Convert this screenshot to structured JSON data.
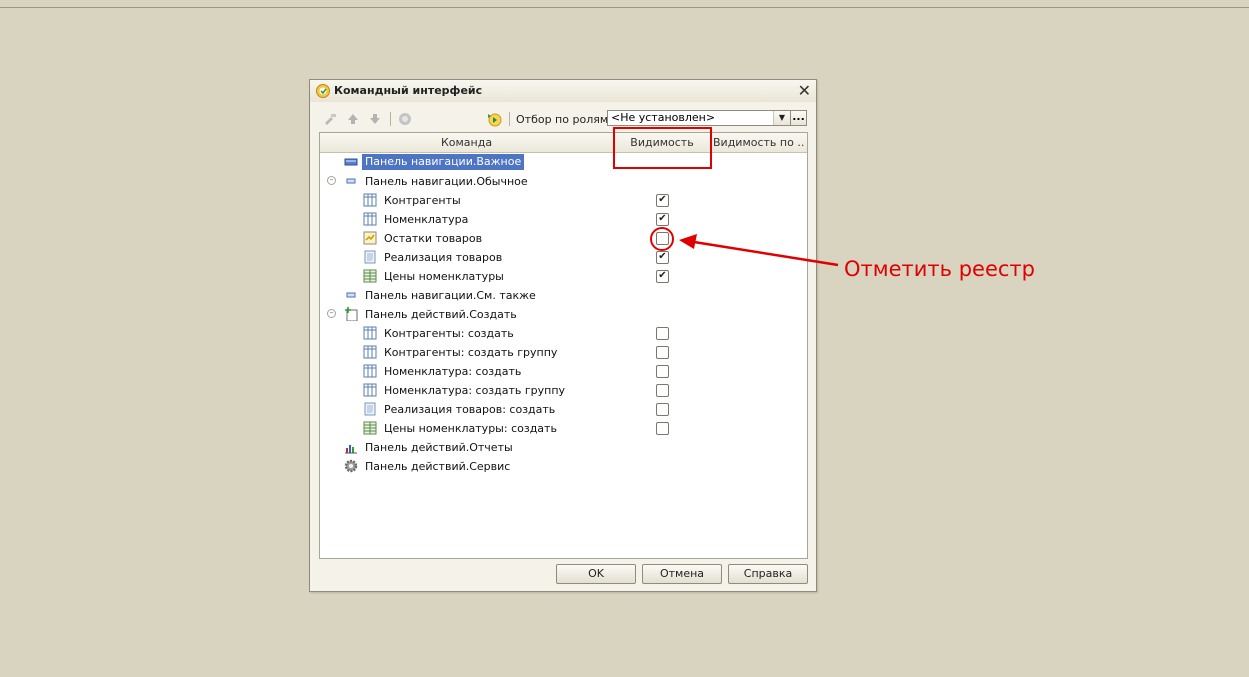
{
  "dialog": {
    "title": "Командный интерфейс",
    "close_glyph": "✕"
  },
  "toolbar": {
    "filter_label": "Отбор по ролям:",
    "filter_value": "<Не установлен>",
    "dots": "..."
  },
  "columns": {
    "command": "Команда",
    "visibility": "Видимость",
    "visibility_default": "Видимость по ..."
  },
  "rows": [
    {
      "label": "Панель навигации.Важное",
      "icon": "nav-panel-important-icon",
      "level": 0,
      "selected": true
    },
    {
      "label": "Панель навигации.Обычное",
      "icon": "nav-panel-icon",
      "level": 0,
      "expanded": true
    },
    {
      "label": "Контрагенты",
      "icon": "catalog-icon",
      "level": 1,
      "visible": true
    },
    {
      "label": "Номенклатура",
      "icon": "catalog-icon",
      "level": 1,
      "visible": true
    },
    {
      "label": "Остатки товаров",
      "icon": "register-icon",
      "level": 1,
      "visible": false
    },
    {
      "label": "Реализация товаров",
      "icon": "document-icon",
      "level": 1,
      "visible": true
    },
    {
      "label": "Цены номенклатуры",
      "icon": "info-register-icon",
      "level": 1,
      "visible": true
    },
    {
      "label": "Панель навигации.См. также",
      "icon": "nav-panel-icon",
      "level": 0
    },
    {
      "label": "Панель действий.Создать",
      "icon": "create-actions-icon",
      "level": 0,
      "expanded": true
    },
    {
      "label": "Контрагенты: создать",
      "icon": "catalog-icon",
      "level": 1,
      "visible": false
    },
    {
      "label": "Контрагенты: создать группу",
      "icon": "catalog-icon",
      "level": 1,
      "visible": false
    },
    {
      "label": "Номенклатура: создать",
      "icon": "catalog-icon",
      "level": 1,
      "visible": false
    },
    {
      "label": "Номенклатура: создать группу",
      "icon": "catalog-icon",
      "level": 1,
      "visible": false
    },
    {
      "label": "Реализация товаров: создать",
      "icon": "document-icon",
      "level": 1,
      "visible": false
    },
    {
      "label": "Цены номенклатуры: создать",
      "icon": "info-register-icon",
      "level": 1,
      "visible": false
    },
    {
      "label": "Панель действий.Отчеты",
      "icon": "reports-icon",
      "level": 0
    },
    {
      "label": "Панель действий.Сервис",
      "icon": "service-gear-icon",
      "level": 0
    }
  ],
  "buttons": {
    "ok": "OK",
    "cancel": "Отмена",
    "help": "Справка"
  },
  "annotation": {
    "text": "Отметить реестр",
    "color": "#e00000"
  },
  "colors": {
    "background": "#d8d4c0",
    "selection": "#4e74c4"
  }
}
